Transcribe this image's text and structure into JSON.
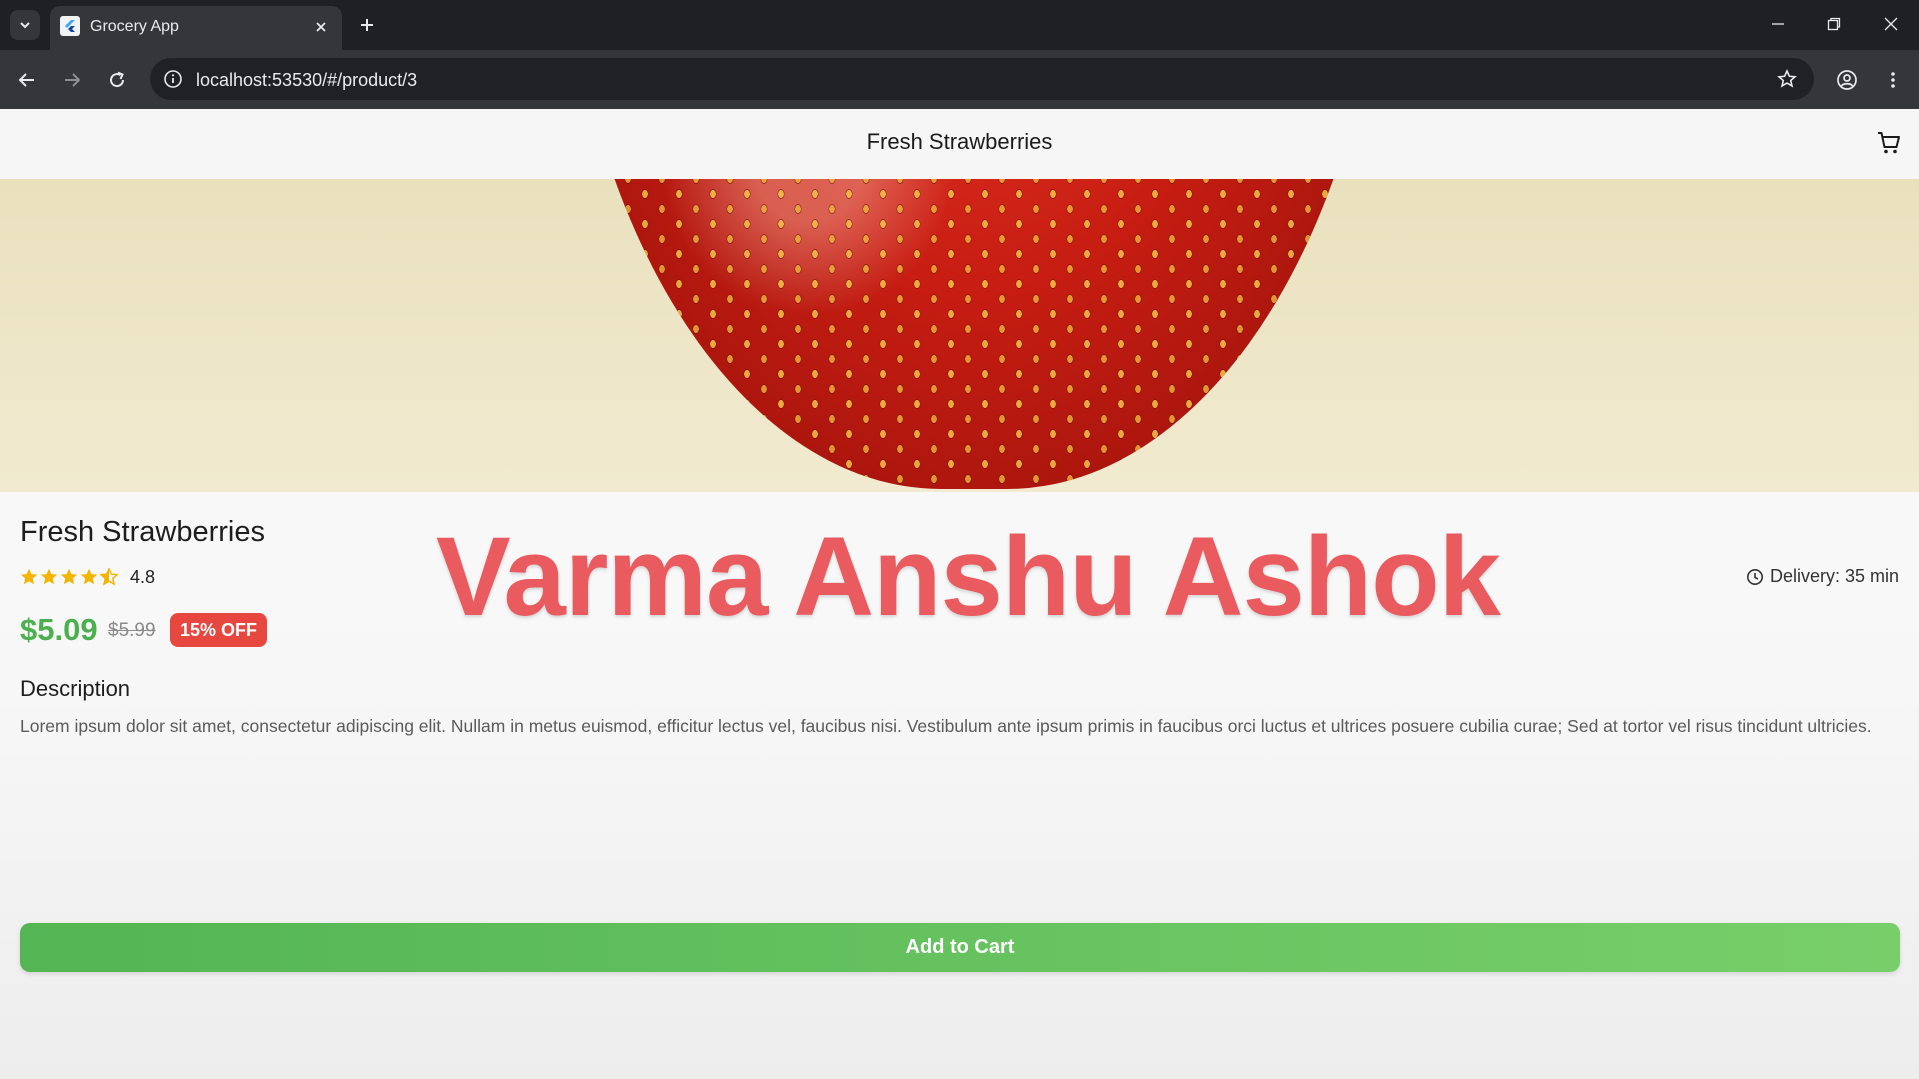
{
  "browser": {
    "tab_title": "Grocery App",
    "url": "localhost:53530/#/product/3"
  },
  "app": {
    "appbar_title": "Fresh Strawberries",
    "product": {
      "name": "Fresh Strawberries",
      "rating": "4.8",
      "rating_value": 4.5,
      "delivery": "Delivery: 35 min",
      "price": "$5.09",
      "old_price": "$5.99",
      "discount": "15% OFF"
    },
    "watermark": "Varma Anshu Ashok",
    "description": {
      "heading": "Description",
      "text": "Lorem ipsum dolor sit amet, consectetur adipiscing elit. Nullam in metus euismod, efficitur lectus vel, faucibus nisi. Vestibulum ante ipsum primis in faucibus orci luctus et ultrices posuere cubilia curae; Sed at tortor vel risus tincidunt ultricies."
    },
    "add_to_cart_label": "Add to Cart"
  },
  "colors": {
    "price": "#4caf50",
    "discount_badge": "#e8473f",
    "star": "#f4b400",
    "watermark": "#e95b5e"
  }
}
